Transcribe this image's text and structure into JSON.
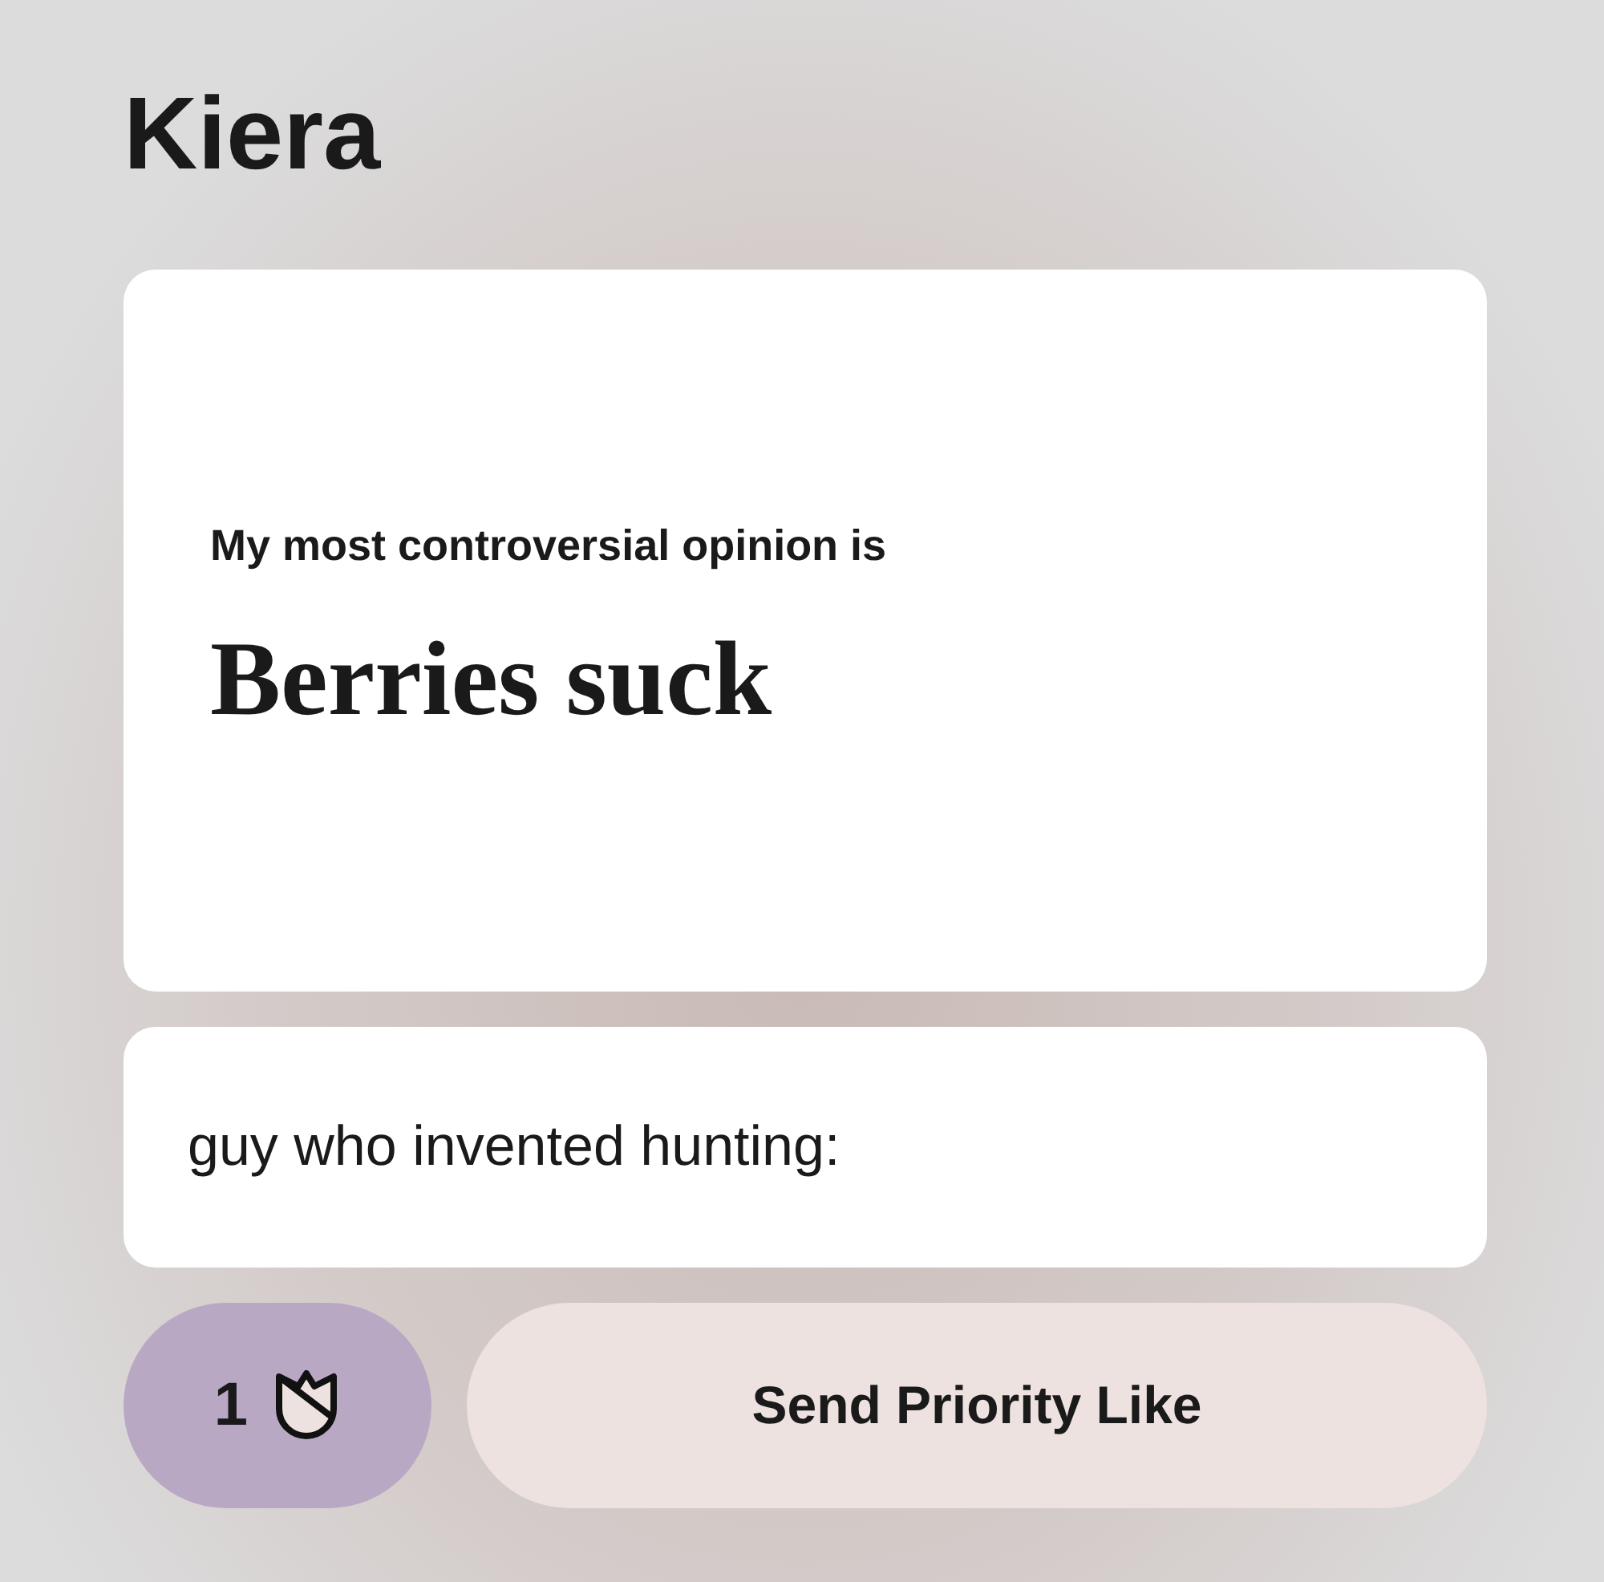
{
  "name": "Kiera",
  "prompt": {
    "question": "My most controversial opinion is",
    "answer": "Berries suck"
  },
  "caption": "guy who invented hunting:",
  "roses": {
    "count": "1"
  },
  "like_button": "Send Priority Like"
}
